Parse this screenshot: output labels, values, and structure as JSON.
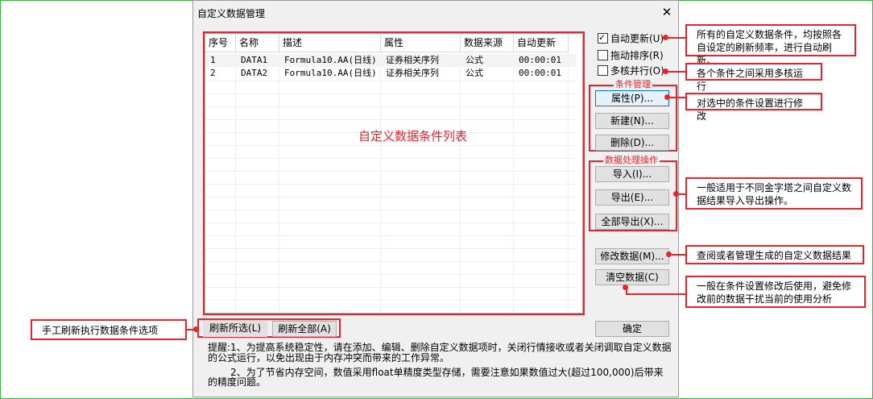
{
  "dialog": {
    "title": "自定义数据管理",
    "close_glyph": "✕"
  },
  "list": {
    "columns": [
      "序号",
      "名称",
      "描述",
      "属性",
      "数据来源",
      "自动更新"
    ],
    "rows": [
      [
        "1",
        "DATA1",
        "Formula10.AA(日线)",
        "证券相关序列",
        "公式",
        "00:00:01"
      ],
      [
        "2",
        "DATA2",
        "Formula10.AA(日线)",
        "证券相关序列",
        "公式",
        "00:00:01"
      ]
    ],
    "watermark": "自定义数据条件列表"
  },
  "options": {
    "auto_update": {
      "label": "自动更新(U)",
      "checked": true
    },
    "drag_sort": {
      "label": "拖动排序(R)",
      "checked": false
    },
    "multicore": {
      "label": "多核并行(O)",
      "checked": false
    }
  },
  "condition_group": {
    "title": "条件管理",
    "properties": "属性(P)...",
    "new": "新建(N)...",
    "delete": "删除(D)..."
  },
  "data_group": {
    "title": "数据处理操作",
    "import": "导入(I)...",
    "export": "导出(E)...",
    "export_all": "全部导出(X)..."
  },
  "modify_data": "修改数据(M)...",
  "clear_data": "清空数据(C)",
  "refresh_selected": "刷新所选(L)",
  "refresh_all": "刷新全部(A)",
  "ok": "确定",
  "notes": {
    "line1": "提醒:1、为提高系统稳定性，请在添加、编辑、删除自定义数据项时，关闭行情接收或者关闭调取自定义数据",
    "line2": "的公式运行，以免出现由于内存冲突而带来的工作异常。",
    "line3": "2、为了节省内存空间，数值采用float单精度类型存储，需要注意如果数值过大(超过100,000)后带来",
    "line4": "的精度问题。"
  },
  "annotations": {
    "auto_update": "所有的自定义数据条件，均按照各自设定的刷新频率，进行自动刷新。",
    "multicore": "各个条件之间采用多核运行",
    "properties": "对选中的条件设置进行修改",
    "import_export": "一般适用于不同金字塔之间自定义数据结果导入导出操作。",
    "modify_data": "查阅或者管理生成的自定义数据结果",
    "clear_data": "一般在条件设置修改后使用，避免修改前的数据干扰当前的使用分析",
    "refresh": "手工刷新执行数据条件选项"
  },
  "colors": {
    "accent_red": "#e8232a",
    "focus_blue": "#0078d7",
    "page_border": "#39b54a"
  }
}
